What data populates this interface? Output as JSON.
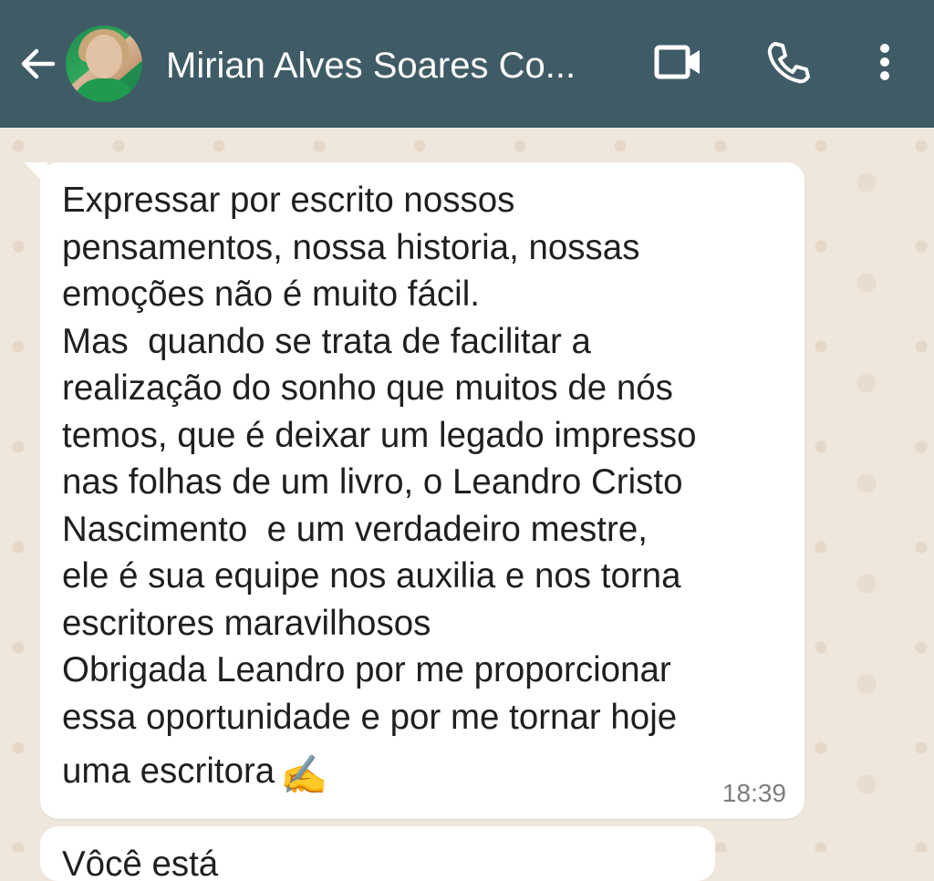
{
  "header": {
    "contact_name": "Mirian Alves Soares Co...",
    "icons": {
      "back": "arrow-left-icon",
      "video": "video-camera-icon",
      "call": "phone-icon",
      "menu": "more-vertical-icon"
    },
    "colors": {
      "bar": "#3f5b66",
      "icon": "#ffffff"
    }
  },
  "message": {
    "lines": [
      "Expressar por escrito nossos",
      "pensamentos, nossa historia, nossas",
      "emoções não é muito fácil.",
      "Mas  quando se trata de facilitar a",
      "realização do sonho que muitos de nós",
      "temos, que é deixar um legado impresso",
      "nas folhas de um livro, o Leandro Cristo",
      "Nascimento  e um verdadeiro mestre,",
      "ele é sua equipe nos auxilia e nos torna",
      "escritores maravilhosos",
      "Obrigada Leandro por me proporcionar",
      "essa oportunidade e por me tornar hoje",
      "uma escritora"
    ],
    "emoji": "✍",
    "time": "18:39"
  },
  "next_message": {
    "partial_text": "Vôcê está"
  }
}
